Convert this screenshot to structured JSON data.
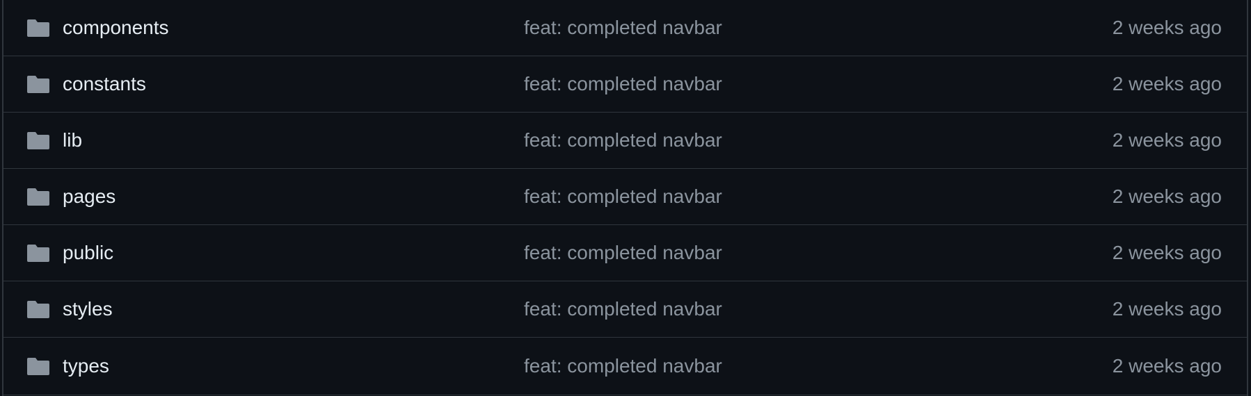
{
  "colors": {
    "background": "#0d1117",
    "border": "#30363d",
    "name_text": "#e6edf3",
    "muted_text": "#8b949e",
    "folder_icon": "#8b949e"
  },
  "files": [
    {
      "icon": "folder-icon",
      "name": "components",
      "commit": "feat: completed navbar",
      "age": "2 weeks ago"
    },
    {
      "icon": "folder-icon",
      "name": "constants",
      "commit": "feat: completed navbar",
      "age": "2 weeks ago"
    },
    {
      "icon": "folder-icon",
      "name": "lib",
      "commit": "feat: completed navbar",
      "age": "2 weeks ago"
    },
    {
      "icon": "folder-icon",
      "name": "pages",
      "commit": "feat: completed navbar",
      "age": "2 weeks ago"
    },
    {
      "icon": "folder-icon",
      "name": "public",
      "commit": "feat: completed navbar",
      "age": "2 weeks ago"
    },
    {
      "icon": "folder-icon",
      "name": "styles",
      "commit": "feat: completed navbar",
      "age": "2 weeks ago"
    },
    {
      "icon": "folder-icon",
      "name": "types",
      "commit": "feat: completed navbar",
      "age": "2 weeks ago"
    }
  ]
}
